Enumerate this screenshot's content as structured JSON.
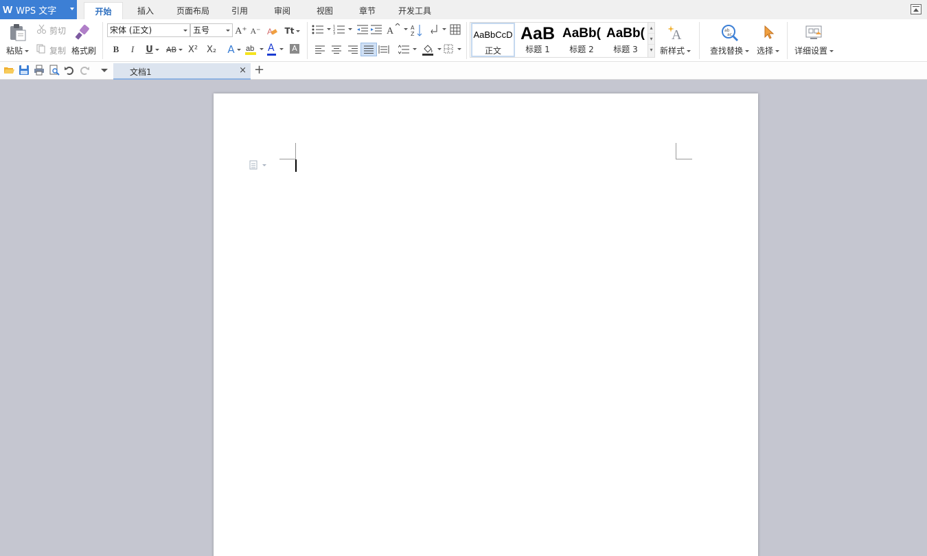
{
  "app": {
    "title": "WPS 文字",
    "logo_letter": "W"
  },
  "menu": {
    "tabs": [
      "开始",
      "插入",
      "页面布局",
      "引用",
      "审阅",
      "视图",
      "章节",
      "开发工具"
    ],
    "active_tab": "开始"
  },
  "clipboard": {
    "paste_label": "粘贴",
    "cut_label": "剪切",
    "copy_label": "复制",
    "format_painter_label": "格式刷"
  },
  "font": {
    "family": "宋体 (正文)",
    "size": "五号",
    "bold_glyph": "B",
    "italic_glyph": "I",
    "underline_glyph": "U",
    "strike_glyph": "AB",
    "superscript_glyph": "X²",
    "subscript_glyph": "X₂",
    "text_effect_glyph": "A",
    "font_color_glyph": "A",
    "char_shading_glyph": "A",
    "grow_glyph": "A⁺",
    "shrink_glyph": "A⁻",
    "phonetic_glyph": "Tt"
  },
  "styles": {
    "items": [
      {
        "sample": "AaBbCcD",
        "name": "正文"
      },
      {
        "sample": "AaB",
        "name": "标题 1"
      },
      {
        "sample": "AaBb(",
        "name": "标题 2"
      },
      {
        "sample": "AaBb(",
        "name": "标题 3"
      }
    ],
    "new_style_label": "新样式"
  },
  "editing": {
    "find_replace_label": "查找替换",
    "select_label": "选择",
    "settings_label": "详细设置"
  },
  "document": {
    "tab_title": "文档1",
    "close_glyph": "×",
    "new_tab_glyph": "+"
  },
  "colors": {
    "accent": "#3c7fd5",
    "font_color": "#1a3bd1",
    "highlight": "#f5e31e",
    "workspace": "#c5c6d0"
  }
}
